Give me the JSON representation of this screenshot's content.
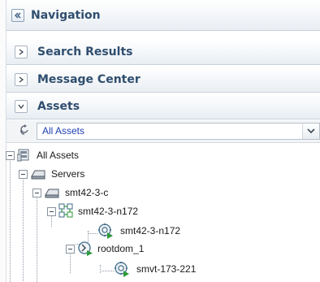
{
  "navigation": {
    "title": "Navigation"
  },
  "sections": [
    {
      "label": "Search Results",
      "state": "collapsed"
    },
    {
      "label": "Message Center",
      "state": "collapsed"
    },
    {
      "label": "Assets",
      "state": "expanded"
    }
  ],
  "assets": {
    "selected_view": "All Assets",
    "tree": [
      {
        "label": "All Assets",
        "icon": "all-assets-icon"
      },
      {
        "label": "Servers",
        "icon": "server-group-icon"
      },
      {
        "label": "smt42-3-c",
        "icon": "server-icon"
      },
      {
        "label": "smt42-3-n172",
        "icon": "cluster-icon"
      },
      {
        "label": "smt42-3-n172",
        "icon": "gear-run-icon"
      },
      {
        "label": "rootdom_1",
        "icon": "domain-icon"
      },
      {
        "label": "smvt-173-221",
        "icon": "gear-run-icon"
      }
    ]
  },
  "colors": {
    "title": "#2f4e6f",
    "select_text": "#1e3fb3",
    "run_green": "#2e9a3a"
  }
}
